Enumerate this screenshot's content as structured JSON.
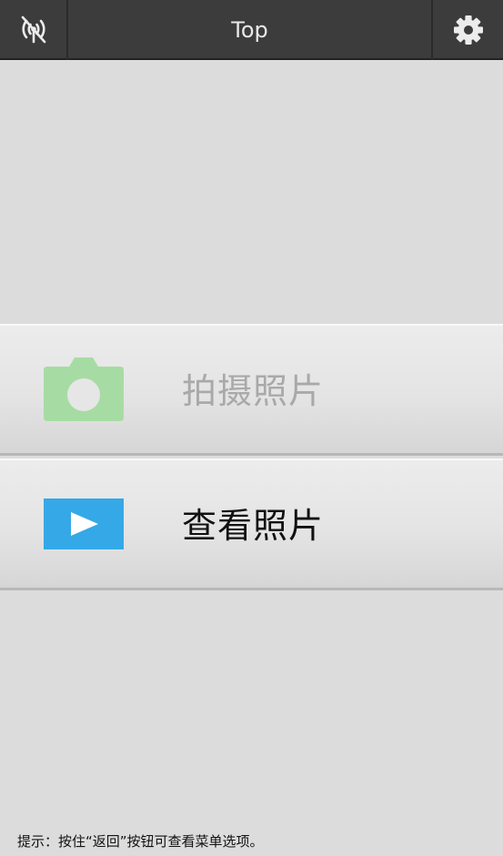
{
  "header": {
    "title": "Top",
    "left_icon": "no-signal-icon",
    "right_icon": "gear-icon",
    "background": "#3c3c3c"
  },
  "menu": {
    "take_photo": {
      "label": "拍摄照片",
      "icon": "camera-icon",
      "icon_color": "#a6dca3",
      "enabled": false
    },
    "view_photos": {
      "label": "查看照片",
      "icon": "play-icon",
      "icon_color": "#35a8e8",
      "enabled": true
    }
  },
  "hint": "提示：按住“返回”按钮可查看菜单选项。"
}
